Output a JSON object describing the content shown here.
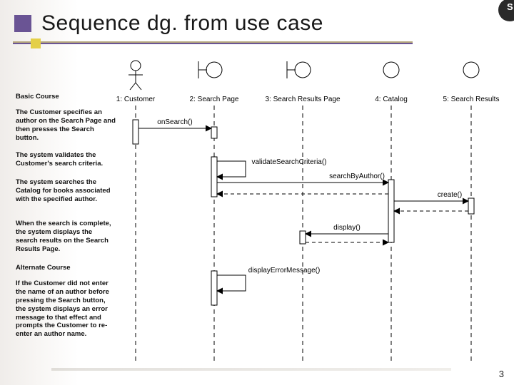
{
  "title": "Sequence dg. from use case",
  "page_number": "3",
  "narration": {
    "basic_heading": "Basic Course",
    "p1": "The Customer specifies an author on the Search Page and then presses the Search button.",
    "p2": "The system validates the Customer's search criteria.",
    "p3": "The system searches the Catalog for books associated with the specified author.",
    "p4": "When the search is complete, the system displays the search results on the Search Results Page.",
    "alt_heading": "Alternate Course",
    "p5": "If the Customer did not enter the name of an author before pressing the Search button, the system displays an error message to that effect and prompts the Customer to re-enter an author name."
  },
  "lifelines": [
    {
      "id": "l1",
      "label": "1: Customer",
      "type": "actor"
    },
    {
      "id": "l2",
      "label": "2: Search Page",
      "type": "boundary"
    },
    {
      "id": "l3",
      "label": "3: Search Results Page",
      "type": "boundary"
    },
    {
      "id": "l4",
      "label": "4: Catalog",
      "type": "entity"
    },
    {
      "id": "l5",
      "label": "5: Search Results",
      "type": "entity"
    }
  ],
  "messages": [
    {
      "from": "l1",
      "to": "l2",
      "label": "onSearch()"
    },
    {
      "from": "l2",
      "to": "l2",
      "label": "validateSearchCriteria()",
      "self": true
    },
    {
      "from": "l2",
      "to": "l4",
      "label": "searchByAuthor()"
    },
    {
      "from": "l4",
      "to": "l5",
      "label": "create()"
    },
    {
      "from": "l4",
      "to": "l3",
      "label": "display()"
    },
    {
      "from": "l2",
      "to": "l2",
      "label": "displayErrorMessage()",
      "self": true
    }
  ]
}
